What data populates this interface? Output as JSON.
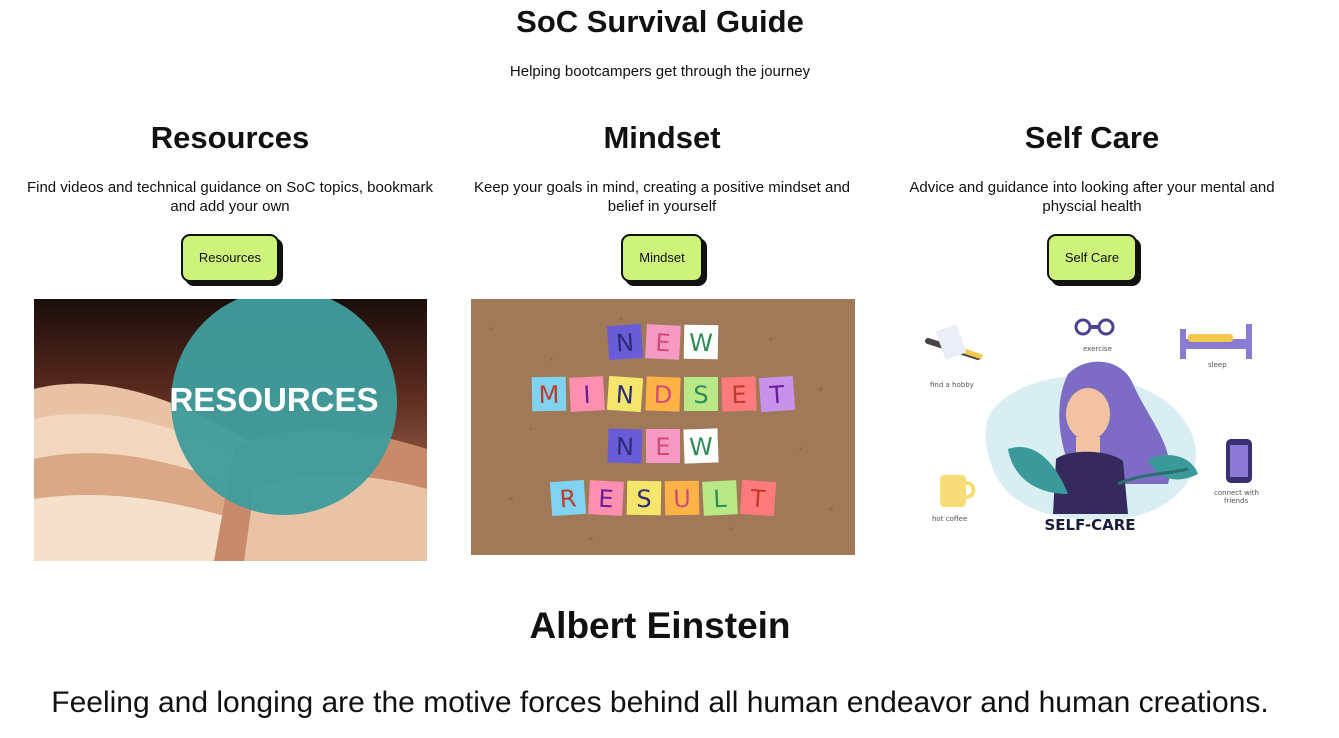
{
  "header": {
    "title": "SoC Survival Guide",
    "subtitle": "Helping bootcampers get through the journey"
  },
  "sections": [
    {
      "heading": "Resources",
      "description": "Find videos and technical guidance on SoC topics, bookmark and add your own",
      "button_label": "Resources",
      "image_text": "RESOURCES"
    },
    {
      "heading": "Mindset",
      "description": "Keep your goals in mind, creating a positive mindset and belief in yourself",
      "button_label": "Mindset",
      "image_words": [
        "NEW",
        "MINDSET",
        "NEW",
        "RESULT"
      ]
    },
    {
      "heading": "Self Care",
      "description": "Advice and guidance into looking after your mental and physcial health",
      "button_label": "Self Care",
      "image_title": "SELF-CARE",
      "image_labels": [
        "find a hobby",
        "exercise",
        "sleep",
        "hot coffee",
        "connect with",
        "friends"
      ]
    }
  ],
  "quote": {
    "author": "Albert Einstein",
    "text": "Feeling and longing are the motive forces behind all human endeavor and human creations."
  },
  "colors": {
    "button_bg": "#cdf37a",
    "teal_circle": "#3f9c9c",
    "cork_board": "#a07a58"
  }
}
